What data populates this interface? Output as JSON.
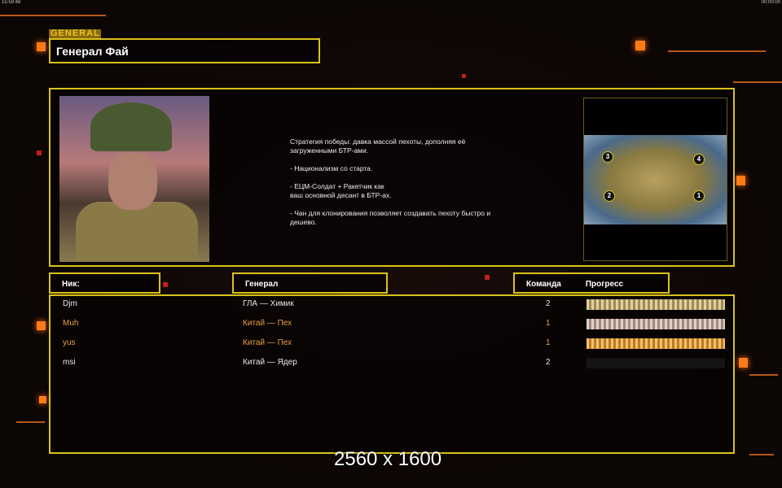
{
  "status": {
    "left": "15:59:48",
    "right": "00:00:00"
  },
  "general_tag": "GENERAL",
  "general_name": "Генерал Фай",
  "description": "Стратегия победы: давка массой пехоты, дополняя её\n загруженными БТР-ами.\n\n- Национализм со старта.\n\n- ЕЦМ-Солдат + Ракетчик как\nваш основной десант в БТР-ах.\n\n- Чан для клонирования позволяет создавать пехоту быстро и\n дешево.",
  "map_slots": [
    "3",
    "4",
    "2",
    "1"
  ],
  "headers": {
    "nick": "Ник:",
    "general": "Генерал",
    "team": "Команда",
    "progress": "Прогресс"
  },
  "players": [
    {
      "nick": "Djm",
      "general": "ГЛА — Химик",
      "team": "2",
      "progress": 100,
      "color": "#e8e8e8"
    },
    {
      "nick": "Muh",
      "general": "Китай — Пех",
      "team": "1",
      "progress": 100,
      "color": "#e8a040"
    },
    {
      "nick": "yus",
      "general": "Китай — Пех",
      "team": "1",
      "progress": 100,
      "color": "#e8a040"
    },
    {
      "nick": "msi",
      "general": "Китай — Ядер",
      "team": "2",
      "progress": 0,
      "color": "#e8e8e8"
    }
  ],
  "watermark": "2560 x 1600"
}
